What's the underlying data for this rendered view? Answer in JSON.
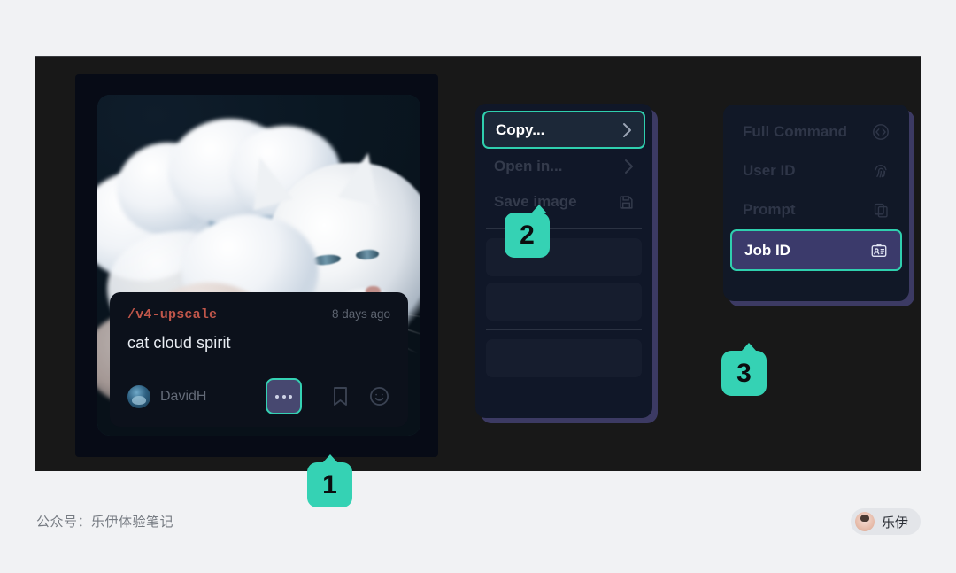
{
  "card": {
    "command": "/v4-upscale",
    "timestamp": "8 days ago",
    "prompt": "cat cloud spirit",
    "author": "DavidH",
    "actions": {
      "more_label": "more-options",
      "bookmark_label": "bookmark",
      "react_label": "add-reaction"
    }
  },
  "context_menu": {
    "items": [
      {
        "label": "Copy...",
        "trailing": "chevron",
        "state": "active"
      },
      {
        "label": "Open in...",
        "trailing": "chevron",
        "state": "dim"
      },
      {
        "label": "Save image",
        "trailing": "save-icon",
        "state": "dim"
      }
    ],
    "placeholder_rows": 3
  },
  "submenu": {
    "items": [
      {
        "label": "Full Command",
        "icon": "code-icon",
        "state": "dim"
      },
      {
        "label": "User ID",
        "icon": "fingerprint-icon",
        "state": "dim"
      },
      {
        "label": "Prompt",
        "icon": "copy-icon",
        "state": "dim"
      },
      {
        "label": "Job ID",
        "icon": "id-badge-icon",
        "state": "active"
      }
    ]
  },
  "callouts": [
    {
      "number": "1",
      "target": "more-options-button"
    },
    {
      "number": "2",
      "target": "copy-menu-item"
    },
    {
      "number": "3",
      "target": "job-id-menu-item"
    }
  ],
  "footer": {
    "text": "公众号：乐伊体验笔记",
    "brand_name": "乐伊"
  },
  "colors": {
    "page_background": "#f1f2f4",
    "stage_background": "#181818",
    "accent_teal": "#35d2b4",
    "highlight_purple": "#3b3a6b",
    "menu_background": "#101728",
    "command_red": "#c0564a"
  }
}
